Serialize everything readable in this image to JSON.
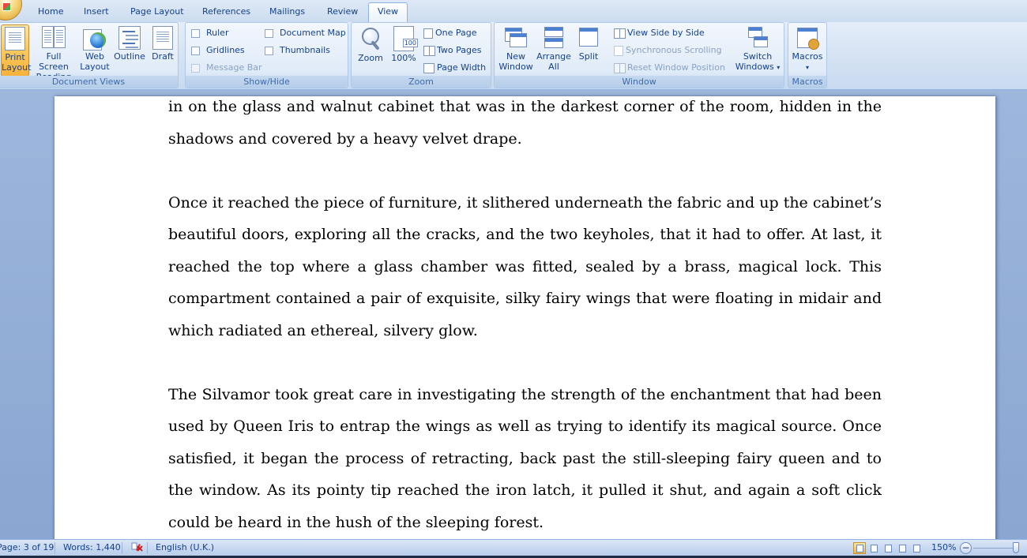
{
  "tabs": [
    "Home",
    "Insert",
    "Page Layout",
    "References",
    "Mailings",
    "Review",
    "View"
  ],
  "active_tab": "View",
  "ribbon": {
    "document_views": {
      "label": "Document Views",
      "print_layout": [
        "Print",
        "Layout"
      ],
      "full_screen_reading": [
        "Full Screen",
        "Reading"
      ],
      "web_layout": [
        "Web",
        "Layout"
      ],
      "outline": "Outline",
      "draft": "Draft"
    },
    "show_hide": {
      "label": "Show/Hide",
      "ruler": "Ruler",
      "gridlines": "Gridlines",
      "message_bar": "Message Bar",
      "document_map": "Document Map",
      "thumbnails": "Thumbnails"
    },
    "zoom": {
      "label": "Zoom",
      "zoom": "Zoom",
      "hundred": "100%",
      "hundred_badge": "100",
      "one_page": "One Page",
      "two_pages": "Two Pages",
      "page_width": "Page Width"
    },
    "window": {
      "label": "Window",
      "new_window": [
        "New",
        "Window"
      ],
      "arrange_all": [
        "Arrange",
        "All"
      ],
      "split": "Split",
      "view_side_by_side": "View Side by Side",
      "synchronous_scrolling": "Synchronous Scrolling",
      "reset_window_position": "Reset Window Position",
      "switch_windows": [
        "Switch",
        "Windows"
      ],
      "switch_arrow": "▾"
    },
    "macros": {
      "label": "Macros",
      "macros": "Macros",
      "arrow": "▾"
    }
  },
  "document": {
    "paragraphs": [
      "in on the glass and walnut cabinet that was in the darkest corner of the room, hidden in the shadows and covered by a heavy velvet drape.",
      "Once it reached the piece of furniture, it slithered underneath the fabric and up the cabinet’s beautiful doors, exploring all the cracks, and the two keyholes, that it had to offer. At last, it reached the top where a glass chamber was fitted, sealed by a brass, magical lock. This compartment contained a pair of exquisite, silky fairy wings that were floating in midair and which radiated an ethereal, silvery glow.",
      "The Silvamor took great care in investigating the strength of the enchantment that had been used by Queen Iris to entrap the wings as well as trying to identify its magical source. Once satisfied, it began the process of retracting, back past the still-sleeping fairy queen and to the window. As its pointy tip reached the iron latch, it pulled it shut, and again a soft click could be heard in the hush of the sleeping forest."
    ]
  },
  "status_bar": {
    "page": "Page: 3 of 19",
    "words": "Words: 1,440",
    "language": "English (U.K.)",
    "zoom": "150%",
    "zoom_out": "−",
    "zoom_in": "+"
  },
  "colors": {
    "ribbon_text": "#15428b",
    "selected_button": "#f8b23b",
    "document_background": "#8ea9d1"
  }
}
